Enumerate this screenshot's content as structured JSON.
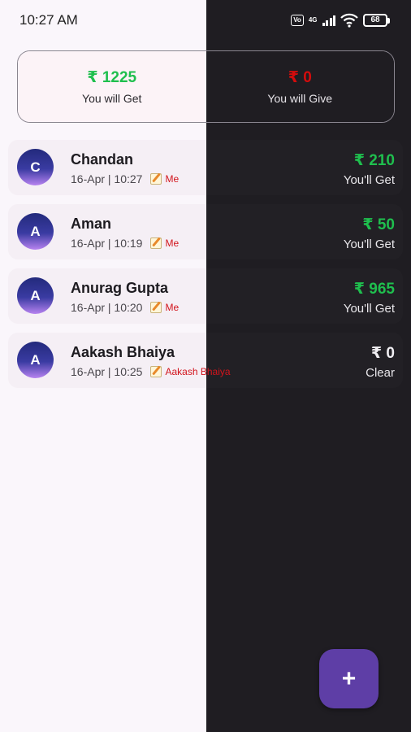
{
  "status_bar": {
    "time": "10:27 AM",
    "volte": "Vo",
    "network": "4G",
    "battery": "68"
  },
  "summary": {
    "get_amount": "₹ 1225",
    "get_label": "You will Get",
    "give_amount": "₹ 0",
    "give_label": "You will Give"
  },
  "contacts": [
    {
      "initial": "C",
      "name": "Chandan",
      "datetime": "16-Apr | 10:27",
      "note": "Me",
      "amount": "₹ 210",
      "status": "You'll Get"
    },
    {
      "initial": "A",
      "name": "Aman",
      "datetime": "16-Apr | 10:19",
      "note": "Me",
      "amount": "₹ 50",
      "status": "You'll Get"
    },
    {
      "initial": "A",
      "name": "Anurag Gupta",
      "datetime": "16-Apr | 10:20",
      "note": "Me",
      "amount": "₹ 965",
      "status": "You'll Get"
    },
    {
      "initial": "A",
      "name": "Aakash Bhaiya",
      "datetime": "16-Apr | 10:25",
      "note": "Aakash Bhaiya",
      "amount": "₹ 0",
      "status": "Clear"
    }
  ],
  "fab": {
    "label": "+"
  },
  "colors": {
    "get_green": "#1fbf4e",
    "give_red": "#d40c0c",
    "fab_purple": "#5e3ea6"
  }
}
